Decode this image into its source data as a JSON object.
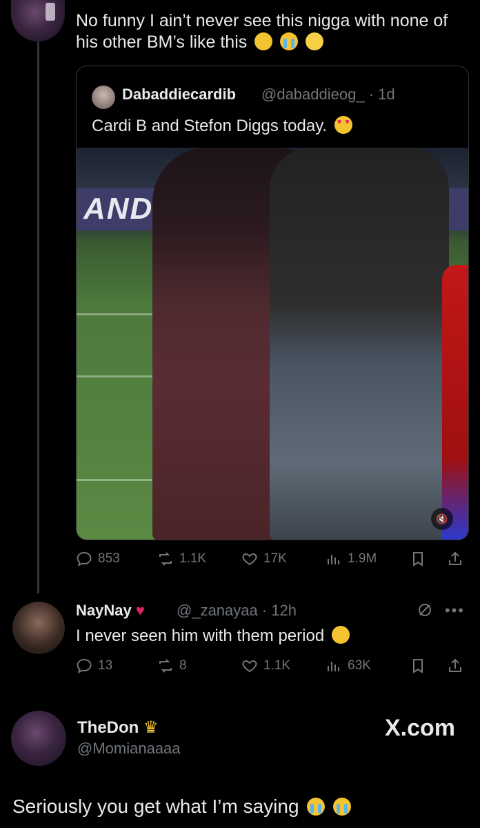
{
  "top_tweet": {
    "text": "No funny I ain’t never see this nigga with none of his other BM’s like this",
    "emojis": [
      "weary-face",
      "loudly-crying-face",
      "pleading-face"
    ]
  },
  "quote": {
    "name": "Dabaddiecardib",
    "handle": "@dabaddieog_",
    "time": "· 1d",
    "text": "Cardi B and Stefon Diggs today.",
    "emoji": "heart-eyes-face",
    "media": {
      "banner_text": "AND"
    }
  },
  "top_actions": {
    "replies": "853",
    "reposts": "1.1K",
    "likes": "17K",
    "views": "1.9M"
  },
  "reply": {
    "name": "NayNay",
    "name_emoji": "red-heart",
    "handle": "@_zanayaa",
    "time": "· 12h",
    "text": "I never seen him with them period",
    "emoji": "rolling-on-floor-laughing",
    "replies": "13",
    "reposts": "8",
    "likes": "1.1K",
    "views": "63K"
  },
  "thedon": {
    "name": "TheDon",
    "name_emoji": "crowned-person",
    "handle": "@Momianaaaa",
    "watermark": "X.com",
    "text": "Seriously you get what I’m saying",
    "emojis": [
      "loudly-crying-face",
      "loudly-crying-face"
    ]
  },
  "colors": {
    "background": "#000000",
    "text": "#e7e9ea",
    "muted": "#71767b",
    "border": "#2f3336",
    "heart": "#e0245e"
  }
}
